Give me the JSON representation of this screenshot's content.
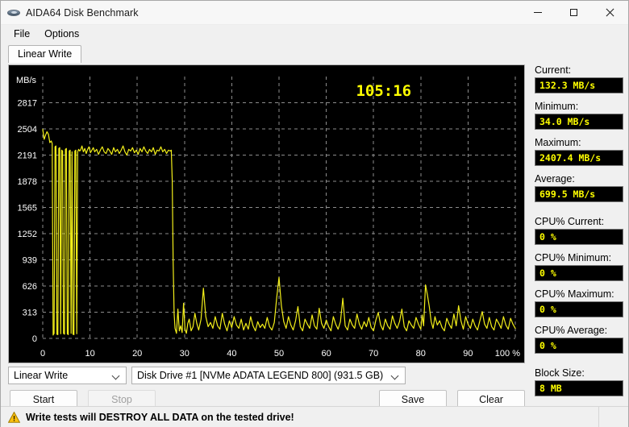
{
  "window": {
    "title": "AIDA64 Disk Benchmark",
    "icon": "disk-icon",
    "minimize": "—",
    "maximize": "□",
    "close": "✕"
  },
  "menu": {
    "items": [
      {
        "label": "File"
      },
      {
        "label": "Options"
      }
    ]
  },
  "tabs": [
    {
      "label": "Linear Write",
      "active": true
    }
  ],
  "chart_overlay": {
    "elapsed": "105:16"
  },
  "stats": [
    {
      "name": "current",
      "label": "Current:",
      "value": "132.3 MB/s",
      "gap": false
    },
    {
      "name": "minimum",
      "label": "Minimum:",
      "value": "34.0 MB/s",
      "gap": false
    },
    {
      "name": "maximum",
      "label": "Maximum:",
      "value": "2407.4 MB/s",
      "gap": false
    },
    {
      "name": "average",
      "label": "Average:",
      "value": "699.5 MB/s",
      "gap": false
    },
    {
      "name": "cpu-current",
      "label": "CPU% Current:",
      "value": "0 %",
      "gap": true
    },
    {
      "name": "cpu-minimum",
      "label": "CPU% Minimum:",
      "value": "0 %",
      "gap": false
    },
    {
      "name": "cpu-maximum",
      "label": "CPU% Maximum:",
      "value": "0 %",
      "gap": false
    },
    {
      "name": "cpu-average",
      "label": "CPU% Average:",
      "value": "0 %",
      "gap": false
    },
    {
      "name": "block-size",
      "label": "Block Size:",
      "value": "8 MB",
      "gap": true
    }
  ],
  "controls": {
    "mode_select": {
      "value": "Linear Write"
    },
    "drive_select": {
      "value": "Disk Drive #1  [NVMe   ADATA LEGEND 800]  (931.5 GB)"
    },
    "start_label": "Start",
    "stop_label": "Stop",
    "stop_disabled": true,
    "save_label": "Save",
    "clear_label": "Clear"
  },
  "warning": {
    "icon": "warning-triangle-icon",
    "text": "Write tests will DESTROY ALL DATA on the tested drive!"
  },
  "colors": {
    "trace": "#f2ee1a",
    "chart_background": "#000000",
    "grid": "#8c8c8c",
    "axis_text": "#ffffff",
    "value_text": "#ffff00",
    "window_background": "#f0f0f0"
  },
  "chart_data": {
    "type": "line",
    "title": "Linear Write",
    "xlabel": "%",
    "ylabel": "MB/s",
    "xlim": [
      0,
      100
    ],
    "ylim": [
      0,
      3130
    ],
    "grid": true,
    "legend": false,
    "xticks": [
      0,
      10,
      20,
      30,
      40,
      50,
      60,
      70,
      80,
      90,
      100
    ],
    "xticklabels": [
      "0",
      "10",
      "20",
      "30",
      "40",
      "50",
      "60",
      "70",
      "80",
      "90",
      "100 %"
    ],
    "yticks": [
      0,
      313,
      626,
      939,
      1252,
      1565,
      1878,
      2191,
      2504,
      2817
    ],
    "yticklabels": [
      "0",
      "313",
      "626",
      "939",
      "1252",
      "1565",
      "1878",
      "2191",
      "2504",
      "2817"
    ],
    "series": [
      {
        "name": "Linear Write Speed",
        "color": "#f2ee1a",
        "x": [
          0.0,
          0.3,
          0.6,
          0.9,
          1.2,
          1.5,
          1.8,
          2.0,
          2.2,
          2.4,
          2.6,
          2.8,
          3.0,
          3.2,
          3.4,
          3.6,
          3.8,
          4.0,
          4.2,
          4.4,
          4.6,
          4.8,
          5.0,
          5.2,
          5.4,
          5.6,
          5.8,
          6.0,
          6.2,
          6.4,
          6.6,
          6.8,
          7.0,
          7.2,
          7.4,
          7.6,
          7.8,
          8.0,
          8.3,
          8.6,
          8.9,
          9.2,
          9.5,
          9.8,
          10.1,
          10.4,
          10.7,
          11.0,
          11.4,
          11.8,
          12.2,
          12.6,
          13.0,
          13.4,
          13.8,
          14.2,
          14.6,
          15.0,
          15.4,
          15.8,
          16.2,
          16.6,
          17.0,
          17.4,
          17.8,
          18.2,
          18.6,
          19.0,
          19.4,
          19.8,
          20.2,
          20.6,
          21.0,
          21.4,
          21.8,
          22.2,
          22.6,
          23.0,
          23.4,
          23.8,
          24.2,
          24.6,
          25.0,
          25.4,
          25.8,
          26.2,
          26.6,
          27.0,
          27.2,
          27.4,
          27.5,
          27.6,
          27.8,
          28.0,
          28.3,
          28.6,
          28.9,
          29.2,
          29.5,
          29.8,
          30.1,
          30.4,
          30.7,
          31.0,
          31.4,
          31.8,
          32.2,
          32.6,
          33.0,
          33.5,
          34.0,
          34.5,
          35.0,
          35.5,
          36.0,
          36.5,
          37.0,
          37.5,
          38.0,
          38.5,
          39.0,
          39.5,
          40.0,
          40.5,
          41.0,
          41.5,
          42.0,
          42.5,
          43.0,
          43.5,
          44.0,
          44.5,
          45.0,
          45.5,
          46.0,
          46.5,
          47.0,
          47.5,
          48.0,
          48.5,
          49.0,
          49.5,
          50.0,
          50.5,
          51.0,
          51.5,
          52.0,
          52.5,
          53.0,
          53.5,
          54.0,
          54.5,
          55.0,
          55.5,
          56.0,
          56.5,
          57.0,
          57.5,
          58.0,
          58.5,
          59.0,
          59.5,
          60.0,
          60.5,
          61.0,
          61.5,
          62.0,
          62.5,
          63.0,
          63.5,
          64.0,
          64.5,
          65.0,
          65.5,
          66.0,
          66.5,
          67.0,
          67.5,
          68.0,
          68.5,
          69.0,
          69.5,
          70.0,
          70.5,
          71.0,
          71.5,
          72.0,
          72.5,
          73.0,
          73.5,
          74.0,
          74.5,
          75.0,
          75.5,
          76.0,
          76.5,
          77.0,
          77.5,
          78.0,
          78.5,
          79.0,
          79.5,
          80.0,
          80.3,
          80.6,
          81.0,
          81.4,
          81.8,
          82.2,
          82.6,
          83.0,
          83.5,
          84.0,
          84.5,
          85.0,
          85.5,
          86.0,
          86.5,
          87.0,
          87.5,
          88.0,
          88.5,
          89.0,
          89.5,
          90.0,
          90.5,
          91.0,
          91.5,
          92.0,
          92.5,
          93.0,
          93.5,
          94.0,
          94.5,
          95.0,
          95.5,
          96.0,
          96.5,
          97.0,
          97.5,
          98.0,
          98.5,
          99.0,
          99.5,
          100.0
        ],
        "y": [
          2500,
          2380,
          2430,
          2470,
          2440,
          2340,
          2360,
          2330,
          40,
          60,
          2290,
          2300,
          50,
          45,
          2270,
          2280,
          55,
          2250,
          2240,
          60,
          50,
          2260,
          2270,
          55,
          45,
          2240,
          2250,
          60,
          2230,
          50,
          45,
          2240,
          2250,
          55,
          2230,
          2260,
          2240,
          2250,
          2300,
          2230,
          2270,
          2210,
          2260,
          2290,
          2220,
          2250,
          2280,
          2230,
          2260,
          2200,
          2250,
          2290,
          2230,
          2210,
          2270,
          2240,
          2200,
          2280,
          2230,
          2260,
          2210,
          2250,
          2300,
          2230,
          2190,
          2260,
          2240,
          2280,
          2220,
          2250,
          2200,
          2270,
          2230,
          2290,
          2240,
          2210,
          2260,
          2230,
          2280,
          2200,
          2250,
          2240,
          2290,
          2230,
          2260,
          2210,
          2250,
          2240,
          2250,
          1900,
          1400,
          900,
          300,
          120,
          60,
          350,
          90,
          150,
          70,
          420,
          110,
          60,
          180,
          230,
          90,
          140,
          300,
          180,
          100,
          230,
          600,
          260,
          140,
          190,
          120,
          260,
          150,
          110,
          300,
          170,
          90,
          210,
          130,
          260,
          160,
          120,
          230,
          100,
          180,
          110,
          260,
          150,
          90,
          200,
          130,
          170,
          120,
          250,
          140,
          100,
          190,
          480,
          730,
          390,
          200,
          120,
          260,
          160,
          100,
          210,
          380,
          140,
          90,
          230,
          170,
          120,
          280,
          150,
          110,
          360,
          180,
          120,
          220,
          140,
          90,
          260,
          170,
          110,
          200,
          480,
          150,
          100,
          230,
          160,
          120,
          290,
          170,
          110,
          200,
          140,
          250,
          130,
          90,
          220,
          310,
          160,
          100,
          230,
          150,
          110,
          270,
          180,
          120,
          200,
          350,
          140,
          90,
          210,
          160,
          120,
          250,
          170,
          110,
          280,
          150,
          640,
          520,
          380,
          200,
          120,
          260,
          160,
          210,
          130,
          90,
          240,
          170,
          120,
          290,
          150,
          390,
          210,
          110,
          260,
          170,
          120,
          230,
          150,
          100,
          210,
          320,
          170,
          120,
          250,
          140,
          100,
          230,
          180,
          120,
          260,
          160,
          110,
          240,
          170,
          120,
          250,
          150,
          100,
          220,
          160,
          200
        ]
      }
    ]
  }
}
